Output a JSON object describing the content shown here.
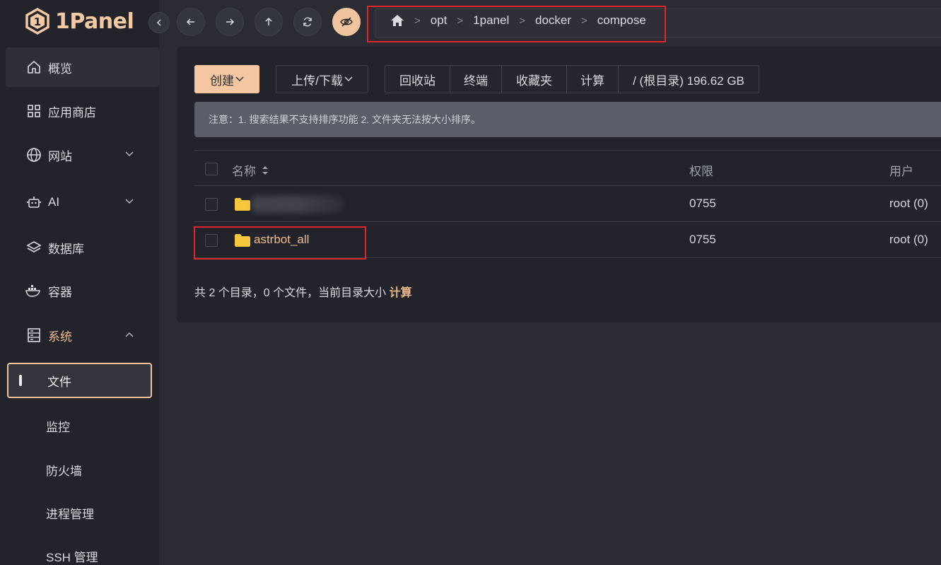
{
  "app": {
    "name": "1Panel"
  },
  "sidebar": {
    "items": [
      {
        "label": "概览",
        "icon": "home-icon"
      },
      {
        "label": "应用商店",
        "icon": "apps-grid-icon"
      },
      {
        "label": "网站",
        "icon": "globe-icon"
      },
      {
        "label": "AI",
        "icon": "robot-icon"
      },
      {
        "label": "数据库",
        "icon": "layers-icon"
      },
      {
        "label": "容器",
        "icon": "docker-icon"
      },
      {
        "label": "系统",
        "icon": "server-icon"
      }
    ],
    "subitems": [
      {
        "label": "文件"
      },
      {
        "label": "监控"
      },
      {
        "label": "防火墙"
      },
      {
        "label": "进程管理"
      },
      {
        "label": "SSH 管理"
      }
    ]
  },
  "breadcrumb": [
    "opt",
    "1panel",
    "docker",
    "compose"
  ],
  "toolbar": {
    "create_label": "创建",
    "upload_label": "上传/下载",
    "group": [
      "回收站",
      "终端",
      "收藏夹",
      "计算",
      "/ (根目录) 196.62 GB"
    ]
  },
  "notice": "注意：1. 搜索结果不支持排序功能 2. 文件夹无法按大小排序。",
  "table": {
    "headers": {
      "name": "名称",
      "perm": "权限",
      "user": "用户"
    },
    "rows": [
      {
        "name": "",
        "perm": "0755",
        "user": "root (0)"
      },
      {
        "name": "astrbot_all",
        "perm": "0755",
        "user": "root (0)"
      }
    ]
  },
  "summary": {
    "text": "共 2 个目录，0 个文件，当前目录大小",
    "link": "计算"
  },
  "colors": {
    "accent": "#f0c49c",
    "highlight": "#e0262a",
    "folder": "#f7c83b"
  }
}
